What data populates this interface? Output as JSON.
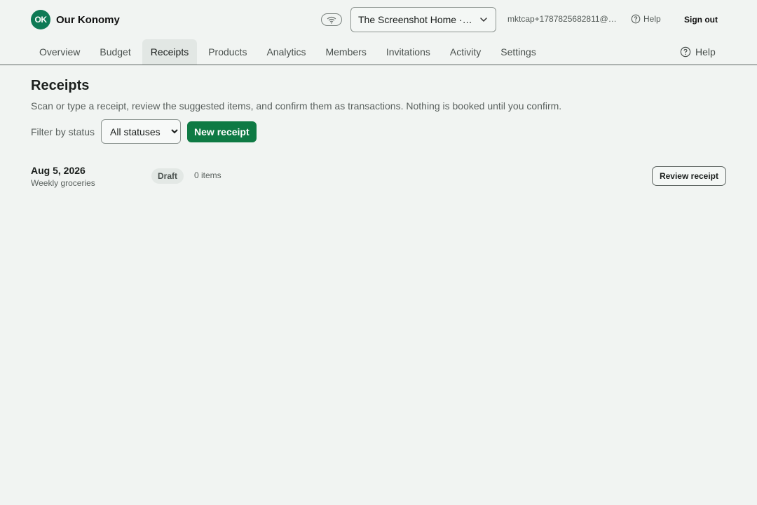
{
  "brand": {
    "logo_text": "OK",
    "name": "Our Konomy",
    "accent": "#0e7a55"
  },
  "header": {
    "household": "The Screenshot Home · Family",
    "email": "mktcap+1787825682811@example.com",
    "help": "Help",
    "sign_out": "Sign out"
  },
  "nav": {
    "tabs": [
      {
        "label": "Overview"
      },
      {
        "label": "Budget"
      },
      {
        "label": "Receipts",
        "active": true
      },
      {
        "label": "Products"
      },
      {
        "label": "Analytics"
      },
      {
        "label": "Members"
      },
      {
        "label": "Invitations"
      },
      {
        "label": "Activity"
      },
      {
        "label": "Settings"
      }
    ],
    "help": "Help"
  },
  "page": {
    "title": "Receipts",
    "subtitle": "Scan or type a receipt, review the suggested items, and confirm them as transactions. Nothing is booked until you confirm.",
    "filter_label": "Filter by status",
    "filter_value": "All statuses",
    "new_receipt": "New receipt"
  },
  "receipts": [
    {
      "date": "Aug 5, 2026",
      "description": "Weekly groceries",
      "status": "Draft",
      "items": "0 items",
      "action": "Review receipt"
    }
  ]
}
